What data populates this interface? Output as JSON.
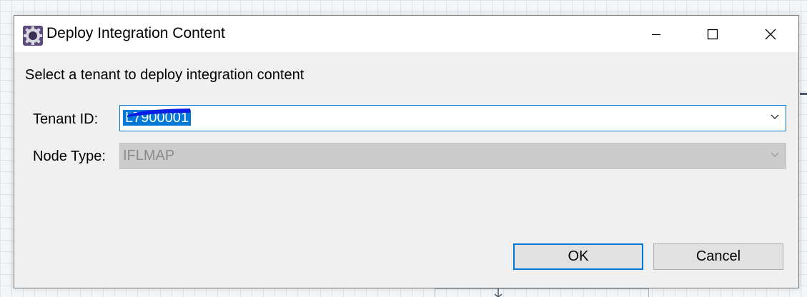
{
  "window": {
    "title": "Deploy Integration Content",
    "icon": "gear-app-icon",
    "controls": {
      "minimize": "minimize-icon",
      "maximize": "maximize-icon",
      "close": "close-icon"
    }
  },
  "instruction": "Select a tenant to deploy integration content",
  "form": {
    "tenant_label": "Tenant ID:",
    "tenant_value": "L7900001",
    "node_label": "Node Type:",
    "node_value": "IFLMAP"
  },
  "buttons": {
    "ok": "OK",
    "cancel": "Cancel"
  },
  "colors": {
    "selection": "#0078d7",
    "redaction": "#0a1ee6",
    "disabled_field": "#cccccc",
    "dialog_bg": "#f0f0f0"
  }
}
